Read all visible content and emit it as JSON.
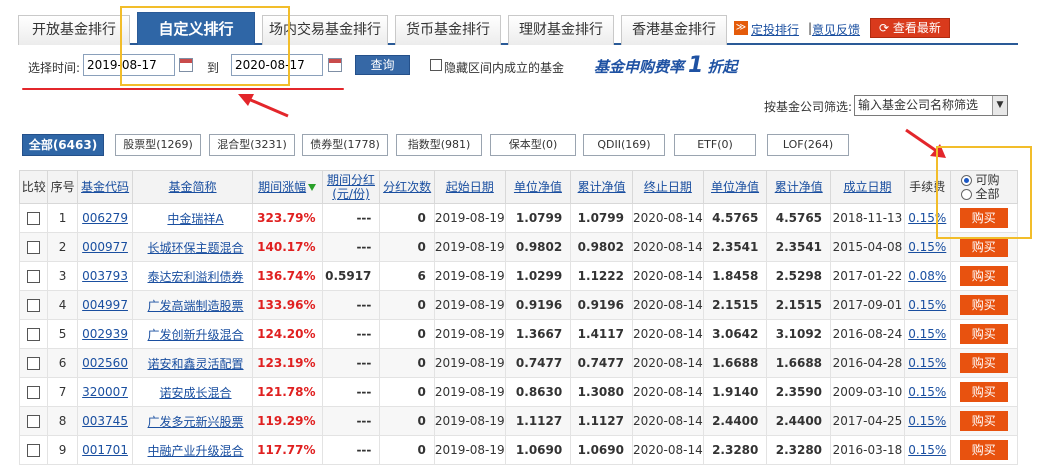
{
  "tabs": [
    {
      "label": "开放基金排行"
    },
    {
      "label": "自定义排行"
    },
    {
      "label": "场内交易基金排行"
    },
    {
      "label": "货币基金排行"
    },
    {
      "label": "理财基金排行"
    },
    {
      "label": "香港基金排行"
    }
  ],
  "top_links": {
    "dt_icon": "≫",
    "dt_rank": "定投排行",
    "feedback": "意见反馈",
    "latest": "查看最新"
  },
  "query": {
    "select_time_label": "选择时间:",
    "start_date": "2019-08-17",
    "to_label": "到",
    "end_date": "2020-08-17",
    "search_button": "查询",
    "hide_label": "隐藏区间内成立的基金",
    "fee_prefix": "基金申购费率",
    "fee_number": "1",
    "fee_suffix": "折起"
  },
  "company_filter": {
    "label": "按基金公司筛选:",
    "placeholder": "输入基金公司名称筛选"
  },
  "categories": [
    {
      "label": "全部(6463)"
    },
    {
      "label": "股票型(1269)"
    },
    {
      "label": "混合型(3231)"
    },
    {
      "label": "债券型(1778)"
    },
    {
      "label": "指数型(981)"
    },
    {
      "label": "保本型(0)"
    },
    {
      "label": "QDII(169)"
    },
    {
      "label": "ETF(0)"
    },
    {
      "label": "LOF(264)"
    }
  ],
  "table": {
    "headers": {
      "compare": "比较",
      "seq": "序号",
      "code": "基金代码",
      "name": "基金简称",
      "change": "期间涨幅",
      "div": "期间分红\n(元/份)",
      "div_times": "分红次数",
      "start_date": "起始日期",
      "unit_nav": "单位净值",
      "acc_nav": "累计净值",
      "end_date": "终止日期",
      "unit_nav2": "单位净值",
      "acc_nav2": "累计净值",
      "found_date": "成立日期",
      "fee": "手续费",
      "buy_opt": "可购",
      "all_opt": "全部"
    },
    "buy_label": "购买",
    "rows": [
      {
        "seq": "1",
        "code": "006279",
        "name": "中金瑞祥A",
        "change": "323.79%",
        "div": "---",
        "div_times": "0",
        "start": "2019-08-19",
        "unav": "1.0799",
        "anav": "1.0799",
        "end": "2020-08-14",
        "unav2": "4.5765",
        "anav2": "4.5765",
        "found": "2018-11-13",
        "fee": "0.15%"
      },
      {
        "seq": "2",
        "code": "000977",
        "name": "长城环保主题混合",
        "change": "140.17%",
        "div": "---",
        "div_times": "0",
        "start": "2019-08-19",
        "unav": "0.9802",
        "anav": "0.9802",
        "end": "2020-08-14",
        "unav2": "2.3541",
        "anav2": "2.3541",
        "found": "2015-04-08",
        "fee": "0.15%"
      },
      {
        "seq": "3",
        "code": "003793",
        "name": "泰达宏利溢利债券",
        "change": "136.74%",
        "div": "0.5917",
        "div_times": "6",
        "start": "2019-08-19",
        "unav": "1.0299",
        "anav": "1.1222",
        "end": "2020-08-14",
        "unav2": "1.8458",
        "anav2": "2.5298",
        "found": "2017-01-22",
        "fee": "0.08%"
      },
      {
        "seq": "4",
        "code": "004997",
        "name": "广发高端制造股票",
        "change": "133.96%",
        "div": "---",
        "div_times": "0",
        "start": "2019-08-19",
        "unav": "0.9196",
        "anav": "0.9196",
        "end": "2020-08-14",
        "unav2": "2.1515",
        "anav2": "2.1515",
        "found": "2017-09-01",
        "fee": "0.15%"
      },
      {
        "seq": "5",
        "code": "002939",
        "name": "广发创新升级混合",
        "change": "124.20%",
        "div": "---",
        "div_times": "0",
        "start": "2019-08-19",
        "unav": "1.3667",
        "anav": "1.4117",
        "end": "2020-08-14",
        "unav2": "3.0642",
        "anav2": "3.1092",
        "found": "2016-08-24",
        "fee": "0.15%"
      },
      {
        "seq": "6",
        "code": "002560",
        "name": "诺安和鑫灵活配置",
        "change": "123.19%",
        "div": "---",
        "div_times": "0",
        "start": "2019-08-19",
        "unav": "0.7477",
        "anav": "0.7477",
        "end": "2020-08-14",
        "unav2": "1.6688",
        "anav2": "1.6688",
        "found": "2016-04-28",
        "fee": "0.15%"
      },
      {
        "seq": "7",
        "code": "320007",
        "name": "诺安成长混合",
        "change": "121.78%",
        "div": "---",
        "div_times": "0",
        "start": "2019-08-19",
        "unav": "0.8630",
        "anav": "1.3080",
        "end": "2020-08-14",
        "unav2": "1.9140",
        "anav2": "2.3590",
        "found": "2009-03-10",
        "fee": "0.15%"
      },
      {
        "seq": "8",
        "code": "003745",
        "name": "广发多元新兴股票",
        "change": "119.29%",
        "div": "---",
        "div_times": "0",
        "start": "2019-08-19",
        "unav": "1.1127",
        "anav": "1.1127",
        "end": "2020-08-14",
        "unav2": "2.4400",
        "anav2": "2.4400",
        "found": "2017-04-25",
        "fee": "0.15%"
      },
      {
        "seq": "9",
        "code": "001701",
        "name": "中融产业升级混合",
        "change": "117.77%",
        "div": "---",
        "div_times": "0",
        "start": "2019-08-19",
        "unav": "1.0690",
        "anav": "1.0690",
        "end": "2020-08-14",
        "unav2": "2.3280",
        "anav2": "2.3280",
        "found": "2016-03-18",
        "fee": "0.15%"
      }
    ]
  },
  "colors": {
    "tab_active": "#2f66a6",
    "buy_button": "#e8520f",
    "change_red": "#e02020",
    "highlight": "#f2bd2a",
    "annotation_red": "#e3262b"
  }
}
